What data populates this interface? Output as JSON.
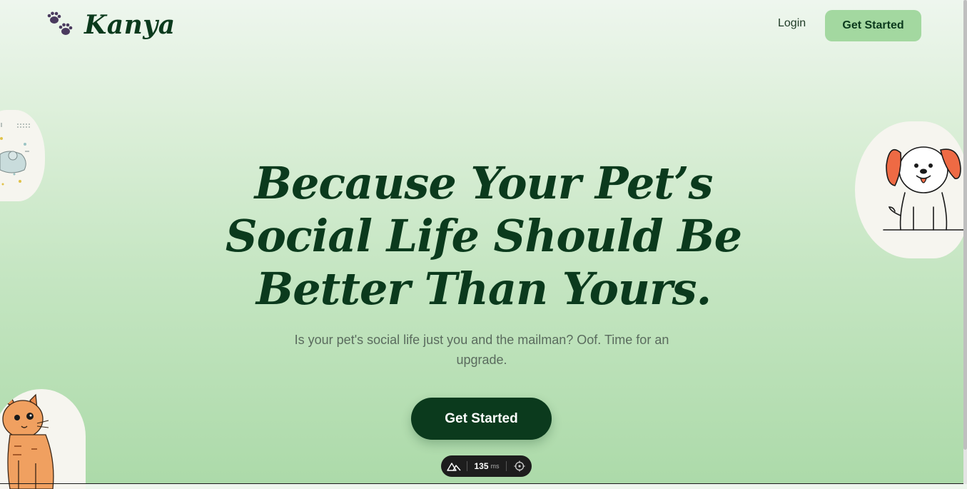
{
  "header": {
    "brand_name": "Kanya",
    "logo_icon": "paw-prints-icon",
    "login_label": "Login",
    "get_started_label": "Get Started"
  },
  "hero": {
    "title": "Because Your Pet’s Social Life Should Be Better Than Yours.",
    "subtitle": "Is your pet's social life just you and the mailman? Oof. Time for an upgrade.",
    "cta_label": "Get Started"
  },
  "illustrations": [
    "dog-cat-pattern-illustration",
    "dog-illustration",
    "cat-illustration"
  ],
  "devtools": {
    "render_time": "135",
    "render_unit": "ms",
    "icons": [
      "nuxt-logo-icon",
      "crosshair-icon"
    ]
  },
  "colors": {
    "brand_dark": "#0b3a1d",
    "accent_green": "#a3d8a0",
    "logo_purple": "#4a3a5e",
    "dog_ear": "#ee6a44"
  }
}
